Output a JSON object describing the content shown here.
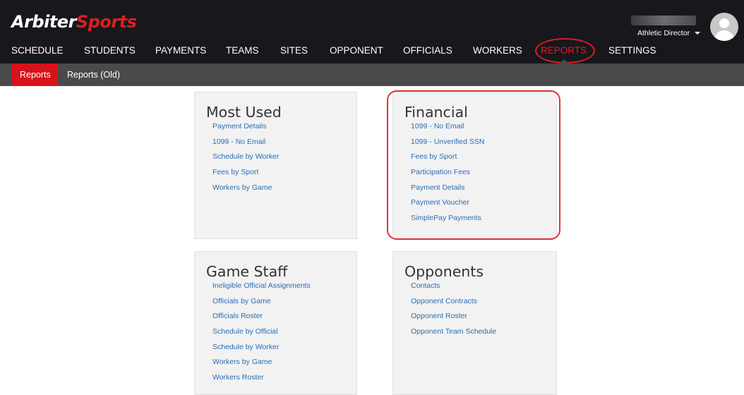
{
  "brand": {
    "part1": "Arbiter",
    "part2": "Sports"
  },
  "nav": {
    "items": [
      {
        "label": "SCHEDULE"
      },
      {
        "label": "STUDENTS"
      },
      {
        "label": "PAYMENTS"
      },
      {
        "label": "TEAMS"
      },
      {
        "label": "SITES"
      },
      {
        "label": "OPPONENT"
      },
      {
        "label": "OFFICIALS"
      },
      {
        "label": "WORKERS"
      },
      {
        "label": "REPORTS",
        "active": true
      },
      {
        "label": "SETTINGS"
      }
    ]
  },
  "user": {
    "role": "Athletic Director"
  },
  "subnav": {
    "items": [
      {
        "label": "Reports",
        "active": true
      },
      {
        "label": "Reports (Old)"
      }
    ]
  },
  "sections": {
    "most_used": {
      "title": "Most Used",
      "links": [
        "Payment Details",
        "1099 - No Email",
        "Schedule by Worker",
        "Fees by Sport",
        "Workers by Game"
      ]
    },
    "financial": {
      "title": "Financial",
      "links": [
        "1099 - No Email",
        "1099 - Unverified SSN",
        "Fees by Sport",
        "Participation Fees",
        "Payment Details",
        "Payment Voucher",
        "SimplePay Payments"
      ]
    },
    "game_staff": {
      "title": "Game Staff",
      "links": [
        "Ineligible Official Assignments",
        "Officials by Game",
        "Officials Roster",
        "Schedule by Official",
        "Schedule by Worker",
        "Workers by Game",
        "Workers Roster"
      ]
    },
    "opponents": {
      "title": "Opponents",
      "links": [
        "Contacts",
        "Opponent Contracts",
        "Opponent Roster",
        "Opponent Team Schedule"
      ]
    }
  },
  "colors": {
    "topbar": "#17171c",
    "subbar": "#4a4a4a",
    "accent_red": "#e11b22",
    "link_blue": "#2a6db5",
    "card_bg": "#f2f2f2"
  },
  "icons": {
    "user_menu": "chevron-down-icon",
    "avatar": "user-avatar-icon"
  }
}
